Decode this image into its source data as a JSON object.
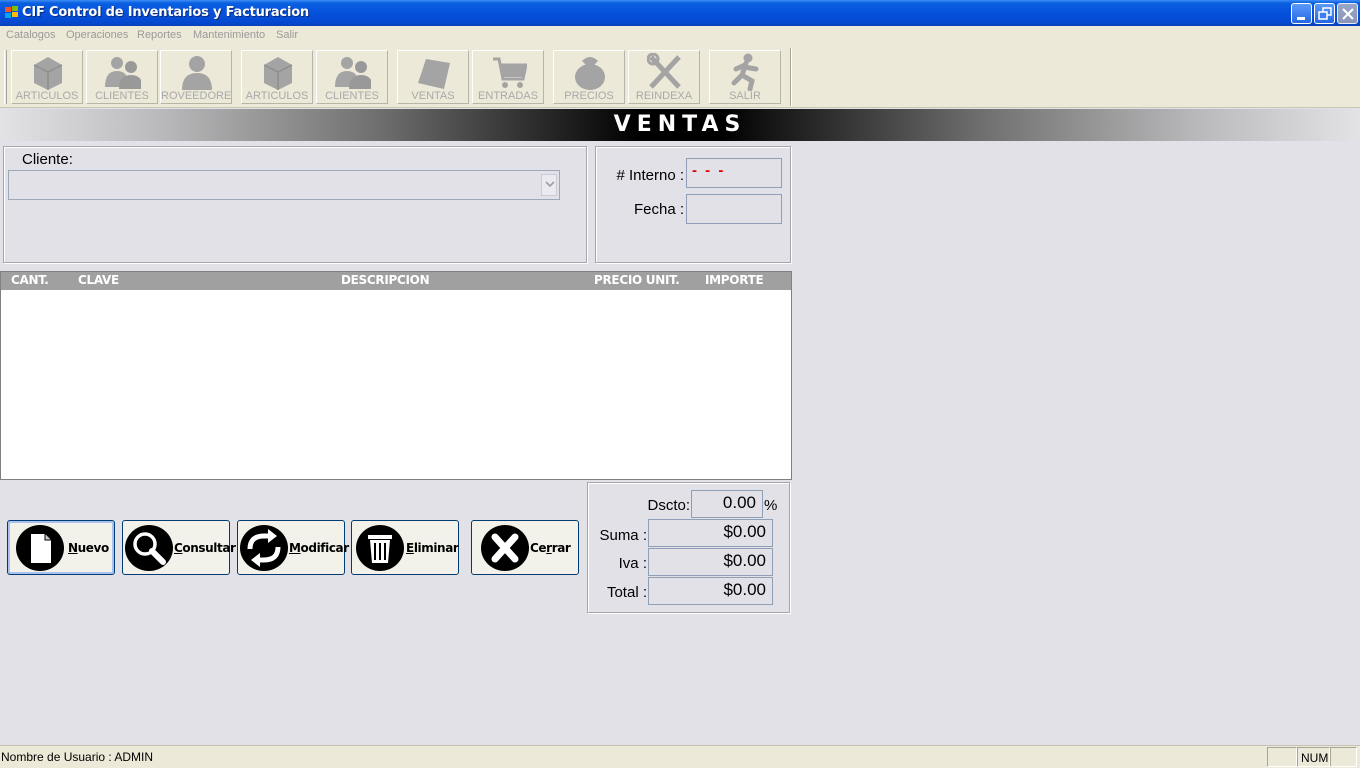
{
  "window": {
    "title": "CIF Control de Inventarios y Facturacion"
  },
  "menu": {
    "items": [
      "Catalogos",
      "Operaciones",
      "Reportes",
      "Mantenimiento",
      "Salir"
    ]
  },
  "toolbar": {
    "buttons": [
      {
        "label": "ARTICULOS",
        "icon": "box-icon"
      },
      {
        "label": "CLIENTES",
        "icon": "people-icon"
      },
      {
        "label": "ROVEEDORE",
        "icon": "supplier-icon"
      },
      {
        "label": "ARTICULOS",
        "icon": "box-icon"
      },
      {
        "label": "CLIENTES",
        "icon": "people-icon"
      },
      {
        "label": "VENTAS",
        "icon": "sales-icon"
      },
      {
        "label": "ENTRADAS",
        "icon": "cart-icon"
      },
      {
        "label": "PRECIOS",
        "icon": "price-bag-icon"
      },
      {
        "label": "REINDEXA",
        "icon": "tools-icon"
      },
      {
        "label": "SALIR",
        "icon": "exit-runner-icon"
      }
    ]
  },
  "banner": {
    "title": "VENTAS"
  },
  "cliente": {
    "label": "Cliente:",
    "value": ""
  },
  "interno": {
    "label": "# Interno :",
    "value": "- - -",
    "fecha_label": "Fecha :",
    "fecha_value": ""
  },
  "grid": {
    "columns": [
      "CANT.",
      "CLAVE",
      "DESCRIPCION",
      "PRECIO UNIT.",
      "IMPORTE"
    ],
    "rows": []
  },
  "actions": {
    "nuevo": {
      "key": "N",
      "rest": "uevo"
    },
    "consultar": {
      "key": "C",
      "rest": "onsultar"
    },
    "modificar": {
      "key": "M",
      "rest": "odificar"
    },
    "eliminar": {
      "key": "E",
      "rest": "liminar"
    },
    "cerrar": {
      "pre": "Ce",
      "key": "r",
      "rest": "rar"
    }
  },
  "totales": {
    "dscto_label": "Dscto:",
    "dscto_value": "0.00",
    "dscto_unit": "%",
    "suma_label": "Suma :",
    "suma_value": "$0.00",
    "iva_label": "Iva :",
    "iva_value": "$0.00",
    "total_label": "Total :",
    "total_value": "$0.00"
  },
  "status": {
    "user": "Nombre de Usuario : ADMIN",
    "num": "NUM"
  },
  "colors": {
    "titlebar": "#0551dc",
    "background": "#e2e1e8",
    "interno_value": "#e00000",
    "grid_header": "#a0a0a0"
  }
}
